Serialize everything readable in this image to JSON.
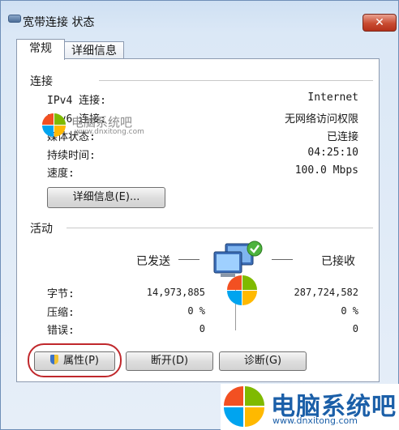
{
  "window": {
    "title": "宽带连接 状态",
    "close_label": "✕"
  },
  "tabs": [
    {
      "label": "常规"
    },
    {
      "label": "详细信息"
    }
  ],
  "connection": {
    "heading": "连接",
    "rows": [
      {
        "label": "IPv4 连接:",
        "value": "Internet"
      },
      {
        "label": "IPv6 连接:",
        "value": "无网络访问权限"
      },
      {
        "label": "媒体状态:",
        "value": "已连接"
      },
      {
        "label": "持续时间:",
        "value": "04:25:10"
      },
      {
        "label": "速度:",
        "value": "100.0 Mbps"
      }
    ],
    "details_button": "详细信息(E)..."
  },
  "activity": {
    "heading": "活动",
    "sent_label": "已发送",
    "received_label": "已接收",
    "rows": [
      {
        "label": "字节:",
        "sent": "14,973,885",
        "received": "287,724,582"
      },
      {
        "label": "压缩:",
        "sent": "0 %",
        "received": "0 %"
      },
      {
        "label": "错误:",
        "sent": "0",
        "received": "0"
      }
    ]
  },
  "buttons": {
    "properties": "属性(P)",
    "disconnect": "断开(D)",
    "diagnose": "诊断(G)"
  },
  "watermark": {
    "small_text": "电脑系统吧",
    "small_url": "www.dnxitong.com",
    "big_text": "电脑系统吧",
    "big_url": "www.dnxitong.com"
  },
  "colors": {
    "highlight_circle": "#c0282c",
    "logo_red": "#f25022",
    "logo_green": "#7fba00",
    "logo_blue": "#00a4ef",
    "logo_yellow": "#ffb900"
  }
}
